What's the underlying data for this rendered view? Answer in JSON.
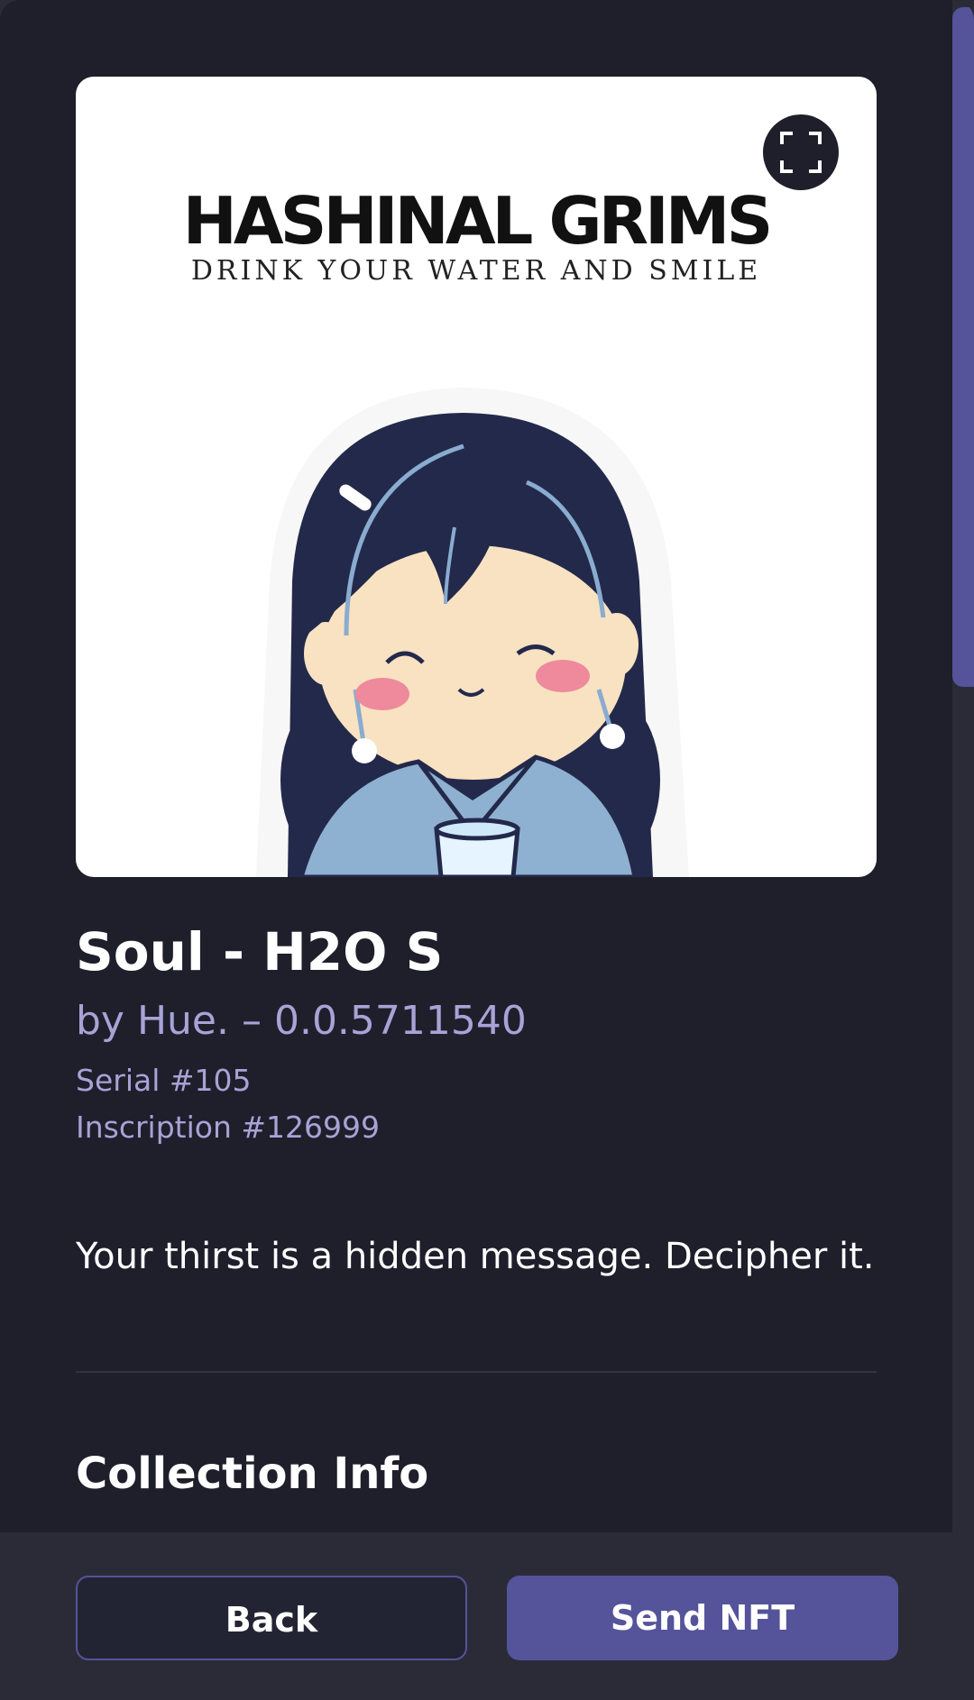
{
  "artwork": {
    "title_text": "HASHINAL GRIMS",
    "subtitle_text": "DRINK YOUR WATER AND SMILE"
  },
  "nft": {
    "name": "Soul - H2O S",
    "byline": "by Hue. – 0.0.5711540",
    "serial": "Serial #105",
    "inscription": "Inscription #126999",
    "description": "Your thirst is a hidden message. Decipher it."
  },
  "sections": {
    "collection_info_heading": "Collection Info"
  },
  "actions": {
    "back_label": "Back",
    "send_label": "Send NFT"
  },
  "icons": {
    "fullscreen": "expand-fullscreen-icon"
  },
  "colors": {
    "background": "#1f1e2b",
    "accent": "#55539a",
    "muted_text": "#a7a3d6",
    "footer": "#2b2b38"
  }
}
